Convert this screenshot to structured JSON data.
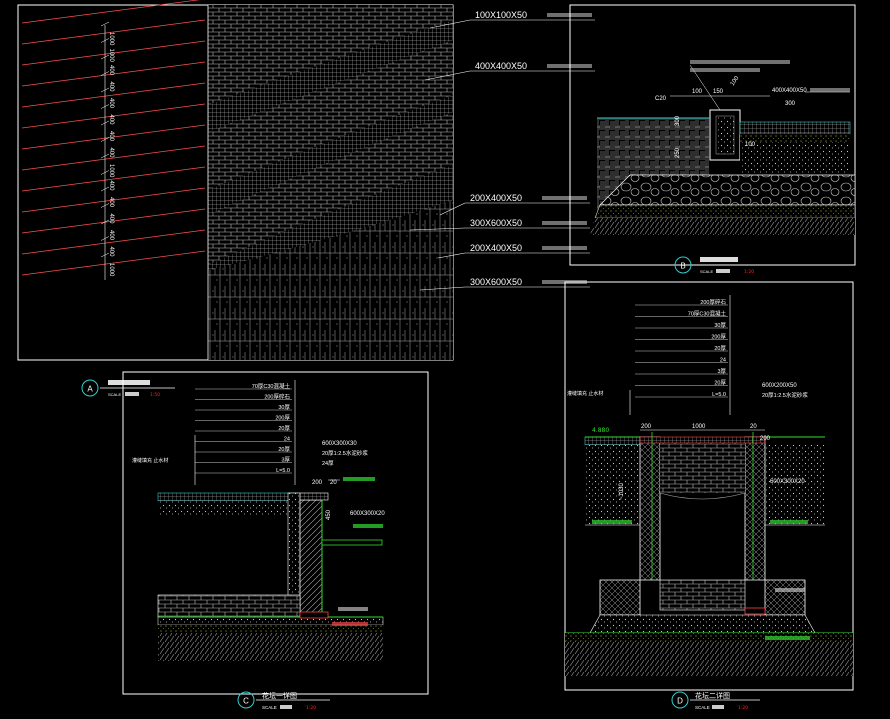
{
  "colors": {
    "background": "#000000",
    "frame": "#ffffff",
    "line": "#e8e8e8",
    "dim_red": "#ff4444",
    "green": "#33dd33",
    "cyan": "#33cccc",
    "yellow": "#e8e850",
    "scale_red": "#ff2222"
  },
  "plan": {
    "tile_labels": [
      "100X100X50",
      "400X400X50",
      "200X400X50",
      "300X600X50",
      "200X400X50",
      "300X600X50"
    ],
    "dims": [
      "1000",
      "1000",
      "400",
      "400",
      "400",
      "400",
      "400",
      "400",
      "1000",
      "400",
      "400",
      "400",
      "400",
      "400",
      "1000"
    ]
  },
  "sections": [
    {
      "letter": "A",
      "scale_label": "SCALE",
      "scale_num": "1:50"
    },
    {
      "letter": "B",
      "scale_label": "SCALE",
      "scale_num": "1:20"
    },
    {
      "letter": "C",
      "title": "花坛一详图",
      "scale_label": "SCALE",
      "scale_num": "1:20"
    },
    {
      "letter": "D",
      "title": "花坛二详图",
      "scale_label": "SCALE",
      "scale_num": "1:20"
    }
  ],
  "detail_b": {
    "dims": [
      "C20",
      "100",
      "150",
      "100",
      "400X400X50",
      "300",
      "100",
      "250"
    ]
  },
  "detail_c": {
    "layers": [
      "70厚C30混凝土",
      "200厚碎石",
      "30厚",
      "200厚",
      "20厚",
      "24",
      "20厚",
      "3厚",
      "L=5.0"
    ],
    "dims": [
      "600X300X30",
      "20厚1:2.5水泥砂浆",
      "24厚",
      "200",
      "20",
      "600X300X20",
      "450"
    ]
  },
  "detail_d": {
    "layers": [
      "200厚碎石",
      "70厚C30混凝土",
      "30厚",
      "200厚",
      "20厚",
      "24",
      "3厚",
      "20厚",
      "L=5.0"
    ],
    "dims": [
      "600X200X50",
      "20厚1:2.5水泥砂浆",
      "4.880",
      "200",
      "1000",
      "20",
      "200",
      "~1030",
      "600X300X20"
    ]
  }
}
